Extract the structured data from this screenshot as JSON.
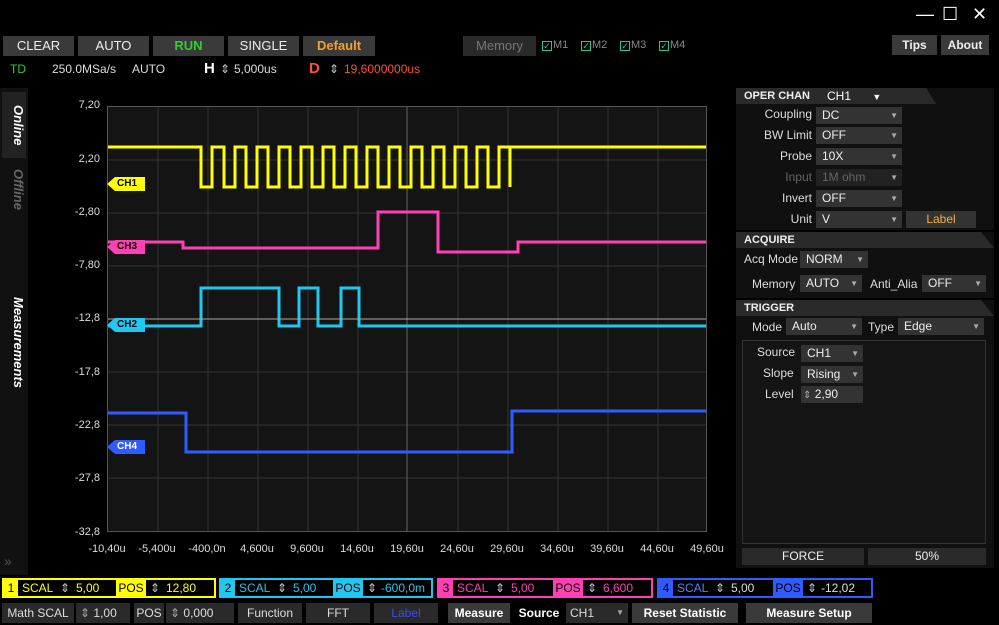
{
  "window": {
    "minimize": "—",
    "maximize": "☐",
    "close": "✕"
  },
  "toolbar": {
    "clear": "CLEAR",
    "auto": "AUTO",
    "run": "RUN",
    "single": "SINGLE",
    "default": "Default",
    "memory": "Memory",
    "m1": "M1",
    "m2": "M2",
    "m3": "M3",
    "m4": "M4",
    "tips": "Tips",
    "about": "About"
  },
  "status": {
    "td": "TD",
    "rate": "250.0MSa/s",
    "mode": "AUTO",
    "h_label": "H",
    "h_value": "5,000us",
    "d_label": "D",
    "d_value": "19,6000000us"
  },
  "tabs": {
    "online": "Online",
    "offline": "Offline",
    "measurements": "Measurements"
  },
  "scope": {
    "y_ticks": [
      "7,20",
      "2,20",
      "-2,80",
      "-7,80",
      "-12,8",
      "-17,8",
      "-22,8",
      "-27,8",
      "-32,8"
    ],
    "x_ticks": [
      "-10,40u",
      "-5,400u",
      "-400,0n",
      "4,600u",
      "9,600u",
      "14,60u",
      "19,60u",
      "24,60u",
      "29,60u",
      "34,60u",
      "39,60u",
      "44,60u",
      "49,60u"
    ],
    "channels": [
      {
        "label": "CH1",
        "color": "#ffff00"
      },
      {
        "label": "CH3",
        "color": "#ff3fb4"
      },
      {
        "label": "CH2",
        "color": "#20c8ef"
      },
      {
        "label": "CH4",
        "color": "#2f5bff"
      }
    ]
  },
  "oper": {
    "title": "OPER CHAN",
    "chan": "CH1",
    "coupling_l": "Coupling",
    "coupling": "DC",
    "bw_l": "BW Limit",
    "bw": "OFF",
    "probe_l": "Probe",
    "probe": "10X",
    "input_l": "Input",
    "input": "1M ohm",
    "invert_l": "Invert",
    "invert": "OFF",
    "unit_l": "Unit",
    "unit": "V",
    "label_btn": "Label"
  },
  "acquire": {
    "title": "ACQUIRE",
    "acq_l": "Acq Mode",
    "acq": "NORM",
    "mem_l": "Memory",
    "mem": "AUTO",
    "alias_l": "Anti_Alia",
    "alias": "OFF"
  },
  "trigger": {
    "title": "TRIGGER",
    "mode_l": "Mode",
    "mode": "Auto",
    "type_l": "Type",
    "type": "Edge",
    "source_l": "Source",
    "source": "CH1",
    "slope_l": "Slope",
    "slope": "Rising",
    "level_l": "Level",
    "level": "2,90",
    "force": "FORCE",
    "pct": "50%"
  },
  "bottom": [
    {
      "num": "1",
      "scal_l": "SCAL",
      "scal": "5,00",
      "pos_l": "POS",
      "pos": "12,80",
      "color": "#ffff00"
    },
    {
      "num": "2",
      "scal_l": "SCAL",
      "scal": "5,00",
      "pos_l": "POS",
      "pos": "-600,0m",
      "color": "#20c8ef"
    },
    {
      "num": "3",
      "scal_l": "SCAL",
      "scal": "5,00",
      "pos_l": "POS",
      "pos": "6,600",
      "color": "#ff3fb4"
    },
    {
      "num": "4",
      "scal_l": "SCAL",
      "scal": "5,00",
      "pos_l": "POS",
      "pos": "-12,02",
      "color": "#2f5bff"
    }
  ],
  "bottom2": {
    "math_l": "Math SCAL",
    "math": "1,00",
    "pos_l": "POS",
    "pos": "0,000",
    "function": "Function",
    "fft": "FFT",
    "label": "Label",
    "measure": "Measure",
    "source_l": "Source",
    "source": "CH1",
    "reset": "Reset  Statistic",
    "setup": "Measure Setup"
  }
}
